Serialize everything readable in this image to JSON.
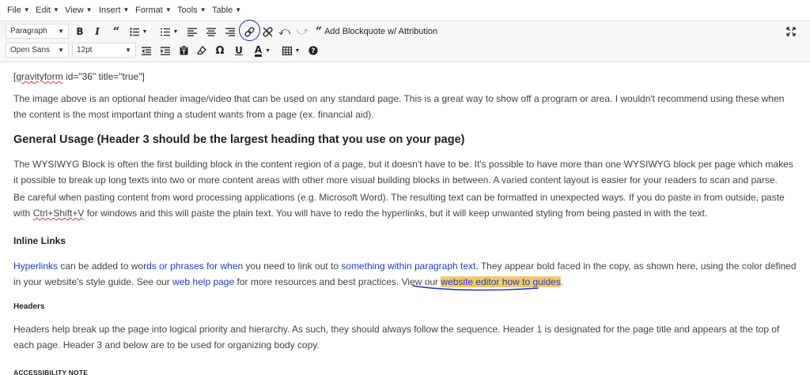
{
  "menubar": {
    "items": [
      {
        "label": "File"
      },
      {
        "label": "Edit"
      },
      {
        "label": "View"
      },
      {
        "label": "Insert"
      },
      {
        "label": "Format"
      },
      {
        "label": "Tools"
      },
      {
        "label": "Table"
      }
    ]
  },
  "toolbar": {
    "paragraph_format": "Paragraph",
    "font_family": "Open Sans",
    "font_size": "12pt",
    "blockquote_attribution_label": "Add Blockquote w/ Attribution"
  },
  "content": {
    "shortcode": {
      "pre": "[",
      "spell": "gravityform",
      "post": " id=\"36\" title=\"true\"]"
    },
    "para1": "The image above is an optional header image/video that can be used on any standard page. This is a great way to show off a program or area. I wouldn't recommend using these when the content is the most important thing a student wants from a page (ex. financial aid).",
    "heading3": "General Usage (Header 3 should be the largest heading that you use on your page)",
    "para2": "The WYSIWYG Block is often the first building block in the content region of a page, but it doesn't have to be. It's possible to have more than one WYSIWYG block per page which makes it possible to break up long texts into two or more content areas with other more visual building blocks in between. A varied content layout is easier for your readers to scan and parse.",
    "para3": {
      "part1": "Be careful when pasting content from word processing applications (e.g. Microsoft Word). The resulting text can be formatted in unexpected ways. If you do paste in from outside, paste with ",
      "shortcut": "Ctrl+Shift+V",
      "part2": " for windows and this will paste the plain text. You will have to redo the hyperlinks, but it will keep unwanted styling from being pasted in with the text."
    },
    "heading4": "Inline Links",
    "para4": {
      "link1": "Hyperlinks",
      "t1": " can be added to wo",
      "link2": "rds or phrases for when",
      "t2": " you need to link out to ",
      "link3": "something within paragraph text",
      "t3": ". They appear bold faced in the copy, as shown here, using the color defined in your website's style guide. See our ",
      "link4": "web help page",
      "t4": " for more resources and best practices. View our ",
      "link5": "website editor how to guides",
      "t5": "."
    },
    "heading5": "Headers",
    "para5": "Headers help break up the page into logical priority and hierarchy. As such, they should always follow the sequence. Header 1 is designated for the page title and appears at the top of each page. Header 3 and below are to be used for organizing body copy.",
    "heading6": "ACCESSIBILITY NOTE"
  },
  "colors": {
    "link": "#1c3fc7",
    "highlight": "#f5c96a",
    "pen_annotation": "#1f2cc9",
    "spellcheck": "#d63638"
  },
  "icons": [
    "bold-icon",
    "italic-icon",
    "blockquote-icon",
    "bullet-list-icon",
    "numbered-list-icon",
    "align-left-icon",
    "align-center-icon",
    "align-right-icon",
    "link-icon",
    "unlink-icon",
    "undo-icon",
    "redo-icon",
    "fullscreen-icon",
    "outdent-icon",
    "indent-icon",
    "paste-text-icon",
    "clear-format-icon",
    "special-character-icon",
    "underline-icon",
    "text-color-icon",
    "table-icon",
    "help-icon"
  ]
}
